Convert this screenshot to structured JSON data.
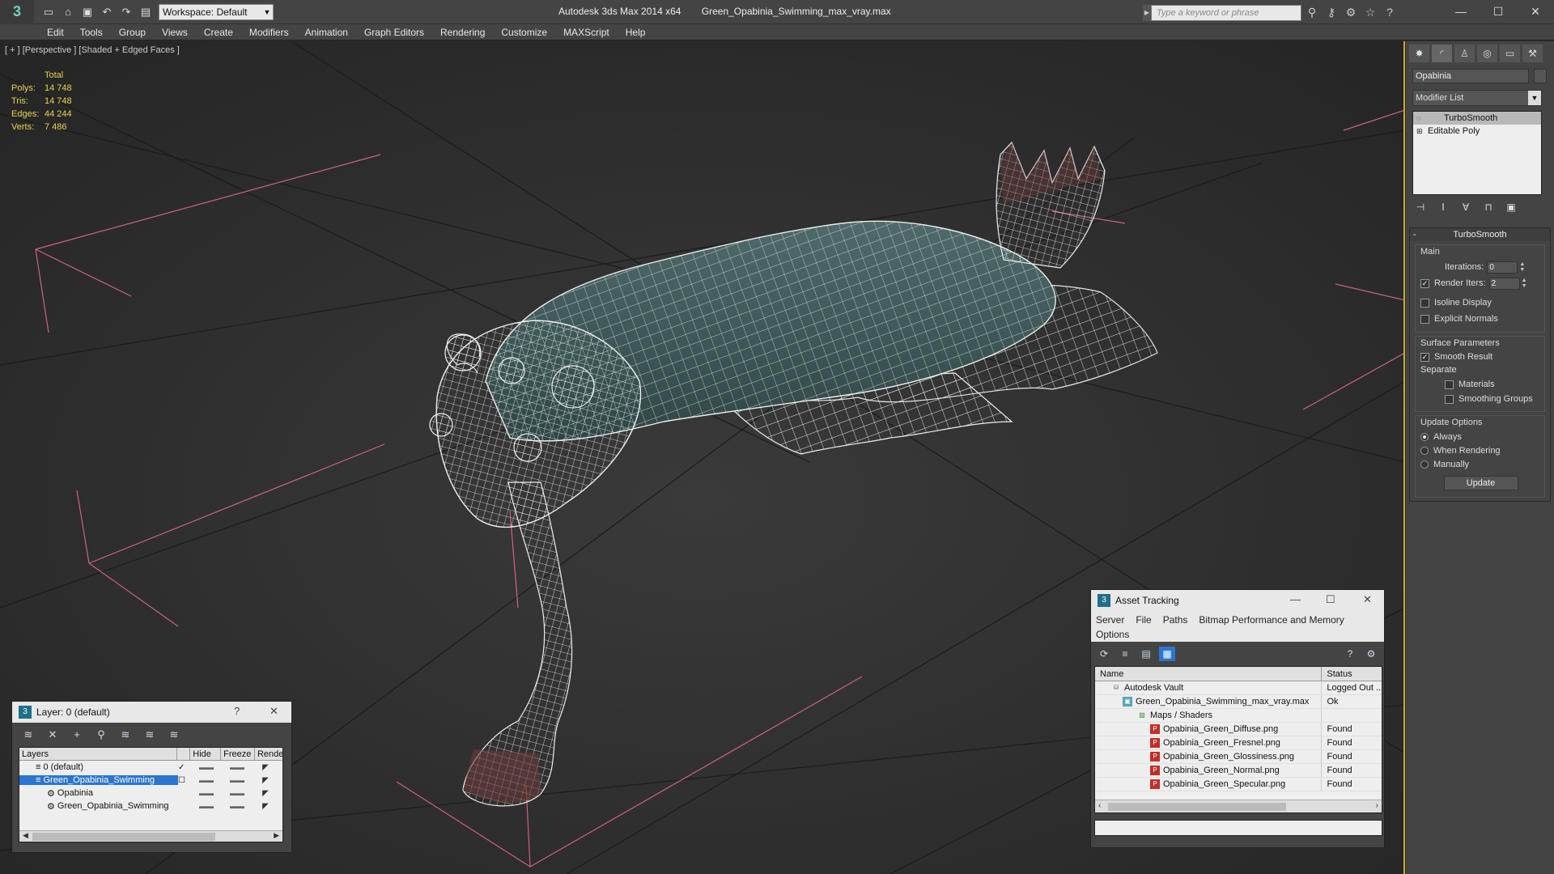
{
  "app": {
    "title": "Autodesk 3ds Max  2014 x64",
    "filename": "Green_Opabinia_Swimming_max_vray.max",
    "workspace": "Workspace: Default",
    "search_placeholder": "Type a keyword or phrase"
  },
  "menu": [
    "Edit",
    "Tools",
    "Group",
    "Views",
    "Create",
    "Modifiers",
    "Animation",
    "Graph Editors",
    "Rendering",
    "Customize",
    "MAXScript",
    "Help"
  ],
  "viewport": {
    "label": "[ + ] [Perspective ] [Shaded + Edged Faces ]",
    "stats": {
      "header": "Total",
      "rows": [
        {
          "k": "Polys:",
          "v": "14 748"
        },
        {
          "k": "Tris:",
          "v": "14 748"
        },
        {
          "k": "Edges:",
          "v": "44 244"
        },
        {
          "k": "Verts:",
          "v": "7 486"
        }
      ]
    }
  },
  "command_panel": {
    "object_name": "Opabinia",
    "modifier_list": "Modifier List",
    "stack": [
      "TurboSmooth",
      "Editable Poly"
    ],
    "rollout_title": "TurboSmooth",
    "main": {
      "title": "Main",
      "iterations_label": "Iterations:",
      "iterations_value": "0",
      "render_iters_label": "Render Iters:",
      "render_iters_value": "2",
      "isoline": "Isoline Display",
      "explicit_normals": "Explicit Normals"
    },
    "surface": {
      "title": "Surface Parameters",
      "smooth_result": "Smooth Result",
      "separate": "Separate",
      "materials": "Materials",
      "smoothing_groups": "Smoothing Groups"
    },
    "update": {
      "title": "Update Options",
      "always": "Always",
      "when_rendering": "When Rendering",
      "manually": "Manually",
      "button": "Update"
    }
  },
  "layer_panel": {
    "title": "Layer: 0 (default)",
    "help": "?",
    "close": "✕",
    "columns": [
      "Layers",
      "Hide",
      "Freeze",
      "Rende"
    ],
    "rows": [
      {
        "name": "0 (default)",
        "indent": 1
      },
      {
        "name": "Green_Opabinia_Swimming",
        "indent": 1
      },
      {
        "name": "Opabinia",
        "indent": 2
      },
      {
        "name": "Green_Opabinia_Swimming",
        "indent": 2
      }
    ]
  },
  "asset_panel": {
    "title": "Asset Tracking",
    "menu": [
      "Server",
      "File",
      "Paths",
      "Bitmap Performance and Memory",
      "Options"
    ],
    "columns": [
      "Name",
      "Status"
    ],
    "rows": [
      {
        "name": "Autodesk Vault",
        "status": "Logged Out ...",
        "indent": 1,
        "icon": "vault"
      },
      {
        "name": "Green_Opabinia_Swimming_max_vray.max",
        "status": "Ok",
        "indent": 2,
        "icon": "max"
      },
      {
        "name": "Maps / Shaders",
        "status": "",
        "indent": 3,
        "icon": "maps"
      },
      {
        "name": "Opabinia_Green_Diffuse.png",
        "status": "Found",
        "indent": 4,
        "icon": "png"
      },
      {
        "name": "Opabinia_Green_Fresnel.png",
        "status": "Found",
        "indent": 4,
        "icon": "png"
      },
      {
        "name": "Opabinia_Green_Glossiness.png",
        "status": "Found",
        "indent": 4,
        "icon": "png"
      },
      {
        "name": "Opabinia_Green_Normal.png",
        "status": "Found",
        "indent": 4,
        "icon": "png"
      },
      {
        "name": "Opabinia_Green_Specular.png",
        "status": "Found",
        "indent": 4,
        "icon": "png"
      }
    ]
  }
}
